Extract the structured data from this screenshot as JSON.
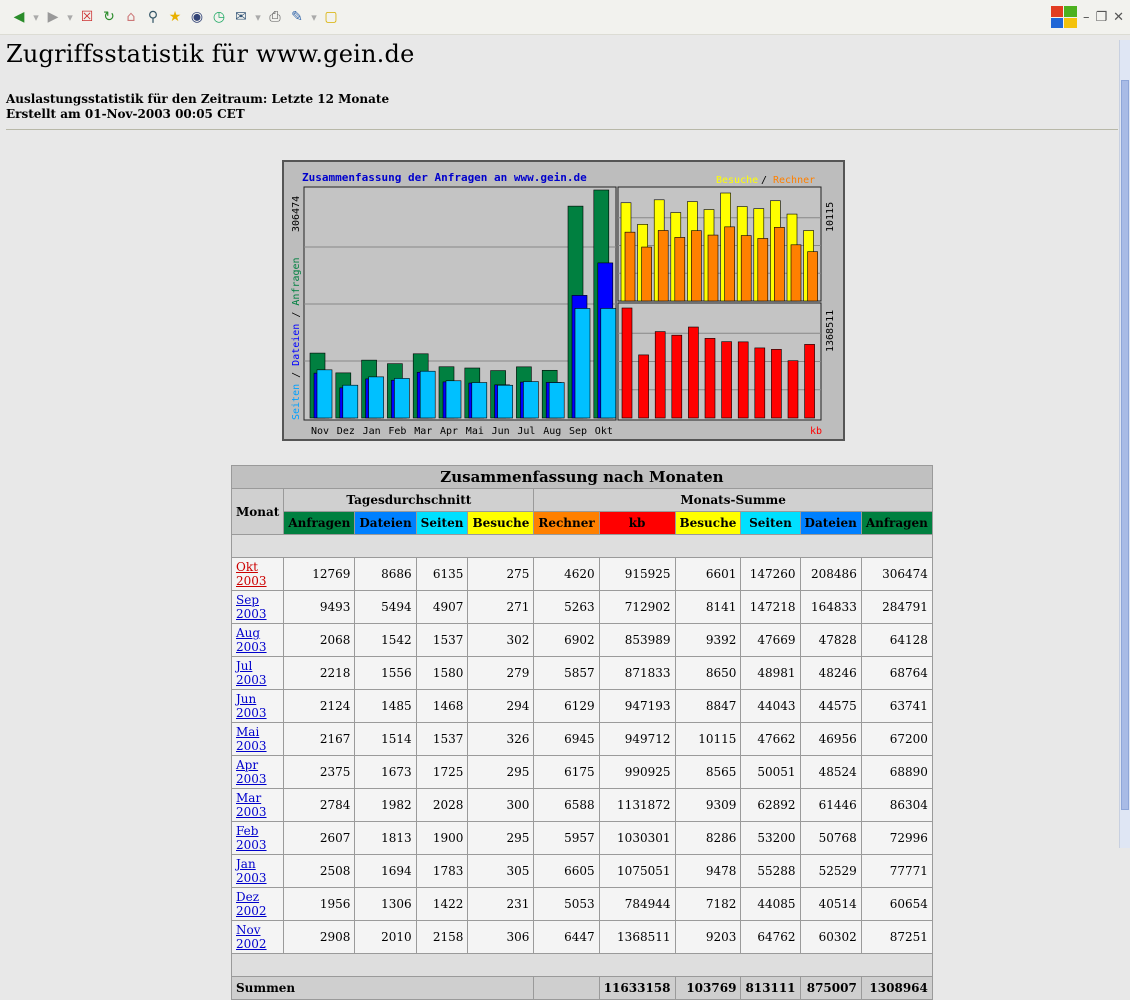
{
  "browser": {
    "toolbar_icons": [
      "back-icon",
      "forward-icon",
      "stop-icon",
      "refresh-icon",
      "home-icon",
      "search-icon",
      "favorites-icon",
      "media-icon",
      "history-icon",
      "mail-icon",
      "print-icon",
      "edit-icon",
      "discuss-icon"
    ],
    "window_controls": [
      "minimize-icon",
      "restore-icon",
      "close-icon"
    ]
  },
  "page": {
    "title": "Zugriffsstatistik für www.gein.de",
    "period": "Auslastungsstatistik für den Zeitraum: Letzte 12 Monate",
    "created": "Erstellt am 01-Nov-2003 00:05 CET"
  },
  "chart": {
    "title": "Zusammenfassung der Anfragen an www.gein.de",
    "legend_besuche": "Besuche",
    "legend_sep": " / ",
    "legend_rechner": "Rechner",
    "left_axis": {
      "seiten": "Seiten",
      "sep1": " / ",
      "dateien": "Dateien",
      "sep2": " / ",
      "anfragen": "Anfragen"
    },
    "left_max": "306474",
    "right_top_max": "10115",
    "right_bottom_max": "1368511",
    "kb_label": "kb"
  },
  "chart_data": {
    "type": "bar",
    "title": "Zusammenfassung der Anfragen an www.gein.de",
    "categories": [
      "Nov",
      "Dez",
      "Jan",
      "Feb",
      "Mar",
      "Apr",
      "Mai",
      "Jun",
      "Jul",
      "Aug",
      "Sep",
      "Okt"
    ],
    "series": [
      {
        "name": "Anfragen",
        "values": [
          87251,
          60654,
          77771,
          72996,
          86304,
          68890,
          67200,
          63741,
          68764,
          64128,
          284791,
          306474
        ]
      },
      {
        "name": "Dateien",
        "values": [
          60302,
          40514,
          52529,
          50768,
          61446,
          48524,
          46956,
          44575,
          48246,
          47828,
          164833,
          208486
        ]
      },
      {
        "name": "Seiten",
        "values": [
          64762,
          44085,
          55288,
          53200,
          62892,
          50051,
          47662,
          44043,
          48981,
          47669,
          147218,
          147260
        ]
      },
      {
        "name": "Besuche",
        "values": [
          9203,
          7182,
          9478,
          8286,
          9309,
          8565,
          10115,
          8847,
          8650,
          9392,
          8141,
          6601
        ]
      },
      {
        "name": "Rechner",
        "values": [
          6447,
          5053,
          6605,
          5957,
          6588,
          6175,
          6945,
          6129,
          5857,
          6902,
          5263,
          4620
        ]
      },
      {
        "name": "kb",
        "values": [
          1368511,
          784944,
          1075051,
          1030301,
          1131872,
          990925,
          949712,
          947193,
          871833,
          853989,
          712902,
          915925
        ]
      }
    ],
    "ylim_left": [
      0,
      306474
    ],
    "ylim_right_top": [
      0,
      10115
    ],
    "ylim_right_bottom": [
      0,
      1368511
    ],
    "colors": {
      "Anfragen": "#008040",
      "Dateien": "#0000ff",
      "Seiten": "#00c0ff",
      "Besuche": "#ffff00",
      "Rechner": "#ff8000",
      "kb": "#ff0000"
    }
  },
  "table": {
    "caption": "Zusammenfassung nach Monaten",
    "col_monat": "Monat",
    "group_daily": "Tagesdurchschnitt",
    "group_monthly": "Monats-Summe",
    "daily_headers": [
      {
        "label": "Anfragen",
        "color": "#008040"
      },
      {
        "label": "Dateien",
        "color": "#0080ff"
      },
      {
        "label": "Seiten",
        "color": "#00e0ff"
      },
      {
        "label": "Besuche",
        "color": "#ffff00"
      }
    ],
    "monthly_headers": [
      {
        "label": "Rechner",
        "color": "#ff8000"
      },
      {
        "label": "kb",
        "color": "#ff0000"
      },
      {
        "label": "Besuche",
        "color": "#ffff00"
      },
      {
        "label": "Seiten",
        "color": "#00e0ff"
      },
      {
        "label": "Dateien",
        "color": "#0080ff"
      },
      {
        "label": "Anfragen",
        "color": "#008040"
      }
    ],
    "rows": [
      {
        "month": "Okt 2003",
        "active": true,
        "vals": [
          "12769",
          "8686",
          "6135",
          "275",
          "4620",
          "915925",
          "6601",
          "147260",
          "208486",
          "306474"
        ]
      },
      {
        "month": "Sep 2003",
        "active": false,
        "vals": [
          "9493",
          "5494",
          "4907",
          "271",
          "5263",
          "712902",
          "8141",
          "147218",
          "164833",
          "284791"
        ]
      },
      {
        "month": "Aug 2003",
        "active": false,
        "vals": [
          "2068",
          "1542",
          "1537",
          "302",
          "6902",
          "853989",
          "9392",
          "47669",
          "47828",
          "64128"
        ]
      },
      {
        "month": "Jul 2003",
        "active": false,
        "vals": [
          "2218",
          "1556",
          "1580",
          "279",
          "5857",
          "871833",
          "8650",
          "48981",
          "48246",
          "68764"
        ]
      },
      {
        "month": "Jun 2003",
        "active": false,
        "vals": [
          "2124",
          "1485",
          "1468",
          "294",
          "6129",
          "947193",
          "8847",
          "44043",
          "44575",
          "63741"
        ]
      },
      {
        "month": "Mai 2003",
        "active": false,
        "vals": [
          "2167",
          "1514",
          "1537",
          "326",
          "6945",
          "949712",
          "10115",
          "47662",
          "46956",
          "67200"
        ]
      },
      {
        "month": "Apr 2003",
        "active": false,
        "vals": [
          "2375",
          "1673",
          "1725",
          "295",
          "6175",
          "990925",
          "8565",
          "50051",
          "48524",
          "68890"
        ]
      },
      {
        "month": "Mar 2003",
        "active": false,
        "vals": [
          "2784",
          "1982",
          "2028",
          "300",
          "6588",
          "1131872",
          "9309",
          "62892",
          "61446",
          "86304"
        ]
      },
      {
        "month": "Feb 2003",
        "active": false,
        "vals": [
          "2607",
          "1813",
          "1900",
          "295",
          "5957",
          "1030301",
          "8286",
          "53200",
          "50768",
          "72996"
        ]
      },
      {
        "month": "Jan 2003",
        "active": false,
        "vals": [
          "2508",
          "1694",
          "1783",
          "305",
          "6605",
          "1075051",
          "9478",
          "55288",
          "52529",
          "77771"
        ]
      },
      {
        "month": "Dez 2002",
        "active": false,
        "vals": [
          "1956",
          "1306",
          "1422",
          "231",
          "5053",
          "784944",
          "7182",
          "44085",
          "40514",
          "60654"
        ]
      },
      {
        "month": "Nov 2002",
        "active": false,
        "vals": [
          "2908",
          "2010",
          "2158",
          "306",
          "6447",
          "1368511",
          "9203",
          "64762",
          "60302",
          "87251"
        ]
      }
    ],
    "totals_label": "Summen",
    "totals": [
      "11633158",
      "103769",
      "813111",
      "875007",
      "1308964"
    ]
  }
}
